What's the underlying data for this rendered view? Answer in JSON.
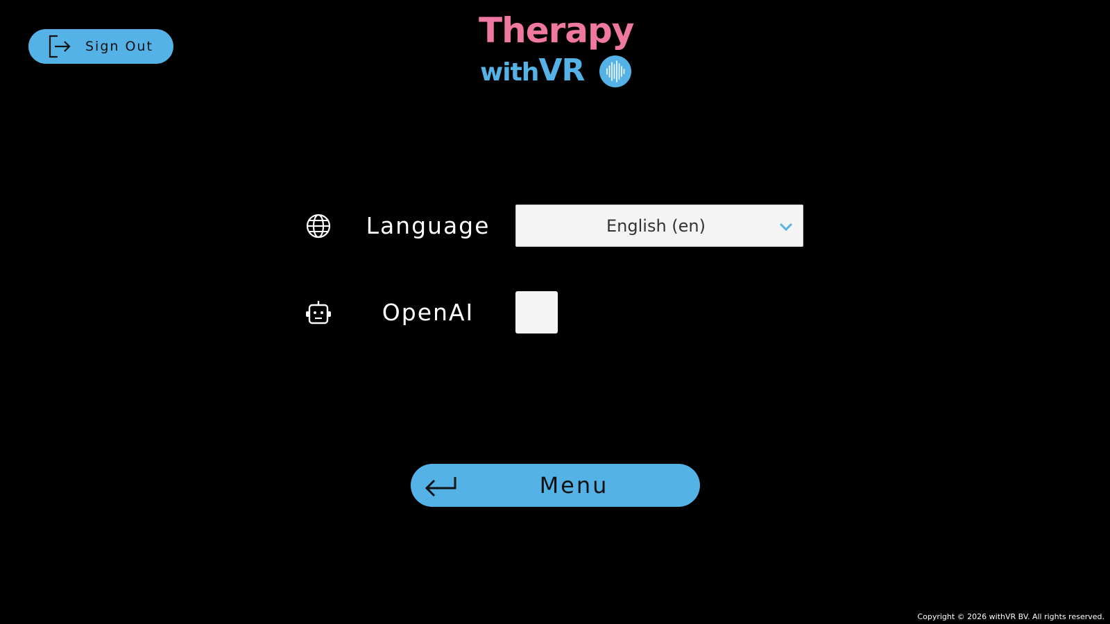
{
  "header": {
    "sign_out_label": "Sign Out",
    "sign_out_icon": "sign-out-icon",
    "logo": {
      "line1": "Therapy",
      "line2_prefix": "with",
      "line2_suffix": "VR",
      "badge_icon": "sound-wave-badge-icon"
    }
  },
  "settings": {
    "language": {
      "icon": "globe-icon",
      "label": "Language",
      "selected": "English (en)"
    },
    "openai": {
      "icon": "robot-icon",
      "label": "OpenAI",
      "checked": false
    }
  },
  "menu_button": {
    "label": "Menu",
    "icon": "return-arrow-icon"
  },
  "footer": {
    "copyright": "Copyright © 2026 withVR BV. All rights reserved."
  },
  "colors": {
    "background": "#000000",
    "accent_blue": "#55b2e6",
    "logo_pink": "#ef78a2",
    "field_bg": "#f4f4f4"
  }
}
